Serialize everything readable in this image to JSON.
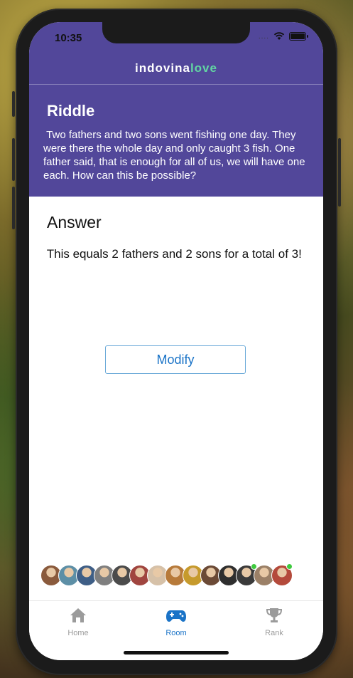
{
  "status_bar": {
    "time": "10:35",
    "signal": "....",
    "wifi_icon": "wifi-icon",
    "battery_icon": "battery-icon"
  },
  "header": {
    "logo_part1": "indovina",
    "logo_part2": "love",
    "colors": {
      "background": "#52479a",
      "logo_accent": "#62d6a3"
    }
  },
  "riddle": {
    "title": "Riddle",
    "text": " Two fathers and two sons went fishing one day. They were there the whole day and only caught 3 fish. One father said, that is enough for all of us, we will have one each. How can this be possible?"
  },
  "answer": {
    "title": "Answer",
    "text": " This equals 2 fathers and 2 sons for a total of 3!"
  },
  "actions": {
    "modify_label": "Modify"
  },
  "players": [
    {
      "name": "player-1",
      "color": "#8a5a3c",
      "online": false
    },
    {
      "name": "player-2",
      "color": "#5d8fa6",
      "online": false
    },
    {
      "name": "player-3",
      "color": "#3e5e86",
      "online": false
    },
    {
      "name": "player-4",
      "color": "#7f7f7f",
      "online": false
    },
    {
      "name": "player-5",
      "color": "#4b4b4b",
      "online": false
    },
    {
      "name": "player-6",
      "color": "#a0453f",
      "online": false
    },
    {
      "name": "player-7",
      "color": "#d6c1a8",
      "online": false
    },
    {
      "name": "player-8",
      "color": "#b77a3a",
      "online": false
    },
    {
      "name": "player-9",
      "color": "#c69a2c",
      "online": false
    },
    {
      "name": "player-10",
      "color": "#6b4a36",
      "online": false
    },
    {
      "name": "player-11",
      "color": "#2e2e2e",
      "online": false
    },
    {
      "name": "player-12",
      "color": "#3a3a3a",
      "online": true
    },
    {
      "name": "player-13",
      "color": "#9b8067",
      "online": false
    },
    {
      "name": "player-14",
      "color": "#b44a3b",
      "online": true
    }
  ],
  "tabbar": {
    "tabs": [
      {
        "label": "Home",
        "icon": "home-icon",
        "active": false
      },
      {
        "label": "Room",
        "icon": "gamepad-icon",
        "active": true
      },
      {
        "label": "Rank",
        "icon": "trophy-icon",
        "active": false
      }
    ],
    "colors": {
      "active": "#1a73c7",
      "inactive": "#9b9b9b"
    }
  }
}
